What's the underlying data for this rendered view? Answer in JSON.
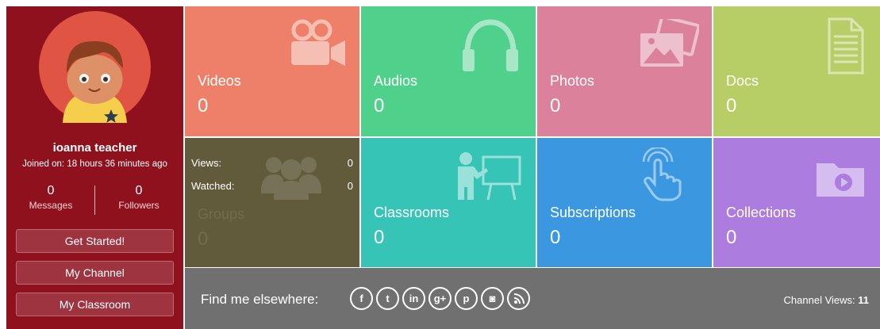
{
  "profile": {
    "name": "ioanna teacher",
    "joined": "Joined on: 18 hours 36 minutes ago",
    "messages_count": "0",
    "messages_label": "Messages",
    "followers_count": "0",
    "followers_label": "Followers",
    "buttons": {
      "get_started": "Get Started!",
      "my_channel": "My Channel",
      "my_classroom": "My Classroom"
    }
  },
  "tiles": {
    "videos": {
      "label": "Videos",
      "count": "0",
      "icon": "video-camera-icon"
    },
    "audios": {
      "label": "Audios",
      "count": "0",
      "icon": "headphones-icon"
    },
    "photos": {
      "label": "Photos",
      "count": "0",
      "icon": "photos-icon"
    },
    "docs": {
      "label": "Docs",
      "count": "0",
      "icon": "document-icon"
    },
    "groups": {
      "label": "Groups",
      "count": "0",
      "icon": "group-icon",
      "views_label": "Views:",
      "views_value": "0",
      "watched_label": "Watched:",
      "watched_value": "0"
    },
    "classrooms": {
      "label": "Classrooms",
      "count": "0",
      "icon": "teacher-board-icon"
    },
    "subscriptions": {
      "label": "Subscriptions",
      "count": "0",
      "icon": "tap-hand-icon"
    },
    "collections": {
      "label": "Collections",
      "count": "0",
      "icon": "folder-play-icon"
    }
  },
  "footer": {
    "find_text": "Find me elsewhere:",
    "socials": [
      {
        "name": "facebook-icon",
        "glyph": "f"
      },
      {
        "name": "twitter-icon",
        "glyph": "t"
      },
      {
        "name": "linkedin-icon",
        "glyph": "in"
      },
      {
        "name": "google-plus-icon",
        "glyph": "g+"
      },
      {
        "name": "pinterest-icon",
        "glyph": "p"
      },
      {
        "name": "instagram-icon",
        "glyph": "◙"
      },
      {
        "name": "rss-icon",
        "glyph": ""
      }
    ],
    "channel_views_label": "Channel Views:",
    "channel_views_value": "11"
  },
  "colors": {
    "profile_bg": "#8e111d",
    "videos": "#ee8069",
    "audios": "#4fd08b",
    "photos": "#dc819b",
    "docs": "#b7cd66",
    "groups": "#615a3b",
    "classrooms": "#35c4b5",
    "subscriptions": "#3b98e0",
    "collections": "#ac7cdf",
    "footer": "#707070"
  }
}
